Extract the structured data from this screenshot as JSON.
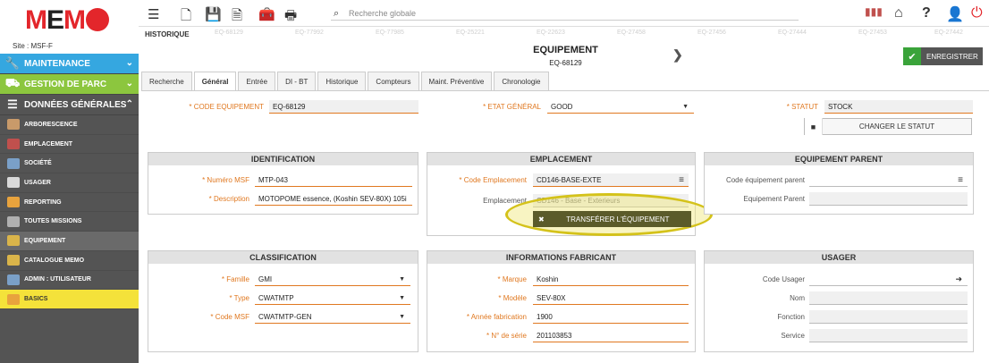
{
  "logo": {
    "text": "MEMO"
  },
  "site": "Site :  MSF-F",
  "sidebar": {
    "sections": [
      {
        "label": "MAINTENANCE",
        "color": "#35a7e0"
      },
      {
        "label": "GESTION DE PARC",
        "color": "#8cc63e"
      },
      {
        "label": "DONNÉES GÉNÉRALES",
        "color": "#545454"
      }
    ],
    "items": [
      {
        "label": "ARBORESCENCE"
      },
      {
        "label": "EMPLACEMENT"
      },
      {
        "label": "SOCIÉTÉ"
      },
      {
        "label": "USAGER"
      },
      {
        "label": "REPORTING"
      },
      {
        "label": "TOUTES MISSIONS"
      },
      {
        "label": "EQUIPEMENT"
      },
      {
        "label": "CATALOGUE MEMO"
      },
      {
        "label": "ADMIN : UTILISATEUR"
      },
      {
        "label": "BASICS"
      }
    ]
  },
  "topbar": {
    "search_placeholder": "Recherche globale",
    "history_label": "HISTORIQUE"
  },
  "history": [
    "EQ-68129",
    "EQ-77992",
    "EQ-77985",
    "EQ-25221",
    "EQ-22623",
    "EQ-27458",
    "EQ-27456",
    "EQ-27444",
    "EQ-27453",
    "EQ-27442"
  ],
  "header": {
    "title": "EQUIPEMENT",
    "subtitle": "EQ-68129",
    "save_label": "ENREGISTRER"
  },
  "tabs": [
    "Recherche",
    "Général",
    "Entrée",
    "DI - BT",
    "Historique",
    "Compteurs",
    "Maint. Préventive",
    "Chronologie"
  ],
  "top_fields": {
    "code_label": "* CODE EQUIPEMENT",
    "code_value": "EQ-68129",
    "etat_label": "* ETAT GÉNÉRAL",
    "etat_value": "GOOD",
    "statut_label": "* STATUT",
    "statut_value": "STOCK",
    "change_status": "CHANGER LE STATUT"
  },
  "identification": {
    "title": "IDENTIFICATION",
    "num_label": "* Numéro MSF",
    "num_value": "MTP-043",
    "desc_label": "* Description",
    "desc_value": "MOTOPOME essence, (Koshin SEV-80X) 105i"
  },
  "emplacement": {
    "title": "EMPLACEMENT",
    "code_label": "* Code Emplacement",
    "code_value": "CD146-BASE-EXTE",
    "empl_label": "Emplacement",
    "empl_value": "CD146 - Base - Exterieurs",
    "transfer_label": "TRANSFÉRER L'ÉQUIPEMENT"
  },
  "parent": {
    "title": "EQUIPEMENT PARENT",
    "code_label": "Code équipement parent",
    "code_value": "",
    "parent_label": "Equipement Parent",
    "parent_value": ""
  },
  "classification": {
    "title": "CLASSIFICATION",
    "famille_label": "* Famille",
    "famille_value": "GMI",
    "type_label": "* Type",
    "type_value": "CWATMTP",
    "msf_label": "* Code MSF",
    "msf_value": "CWATMTP-GEN"
  },
  "fabricant": {
    "title": "INFORMATIONS FABRICANT",
    "marque_label": "* Marque",
    "marque_value": "Koshin",
    "modele_label": "* Modèle",
    "modele_value": "SEV-80X",
    "annee_label": "* Année fabrication",
    "annee_value": "1900",
    "serie_label": "* N° de série",
    "serie_value": "201103853"
  },
  "usager": {
    "title": "USAGER",
    "code_label": "Code Usager",
    "code_value": "",
    "nom_label": "Nom",
    "nom_value": "",
    "fonction_label": "Fonction",
    "fonction_value": "",
    "service_label": "Service",
    "service_value": ""
  },
  "colors": {
    "accent": "#e07820",
    "save_check": "#3aa33a",
    "highlight": "#d4c21a"
  }
}
